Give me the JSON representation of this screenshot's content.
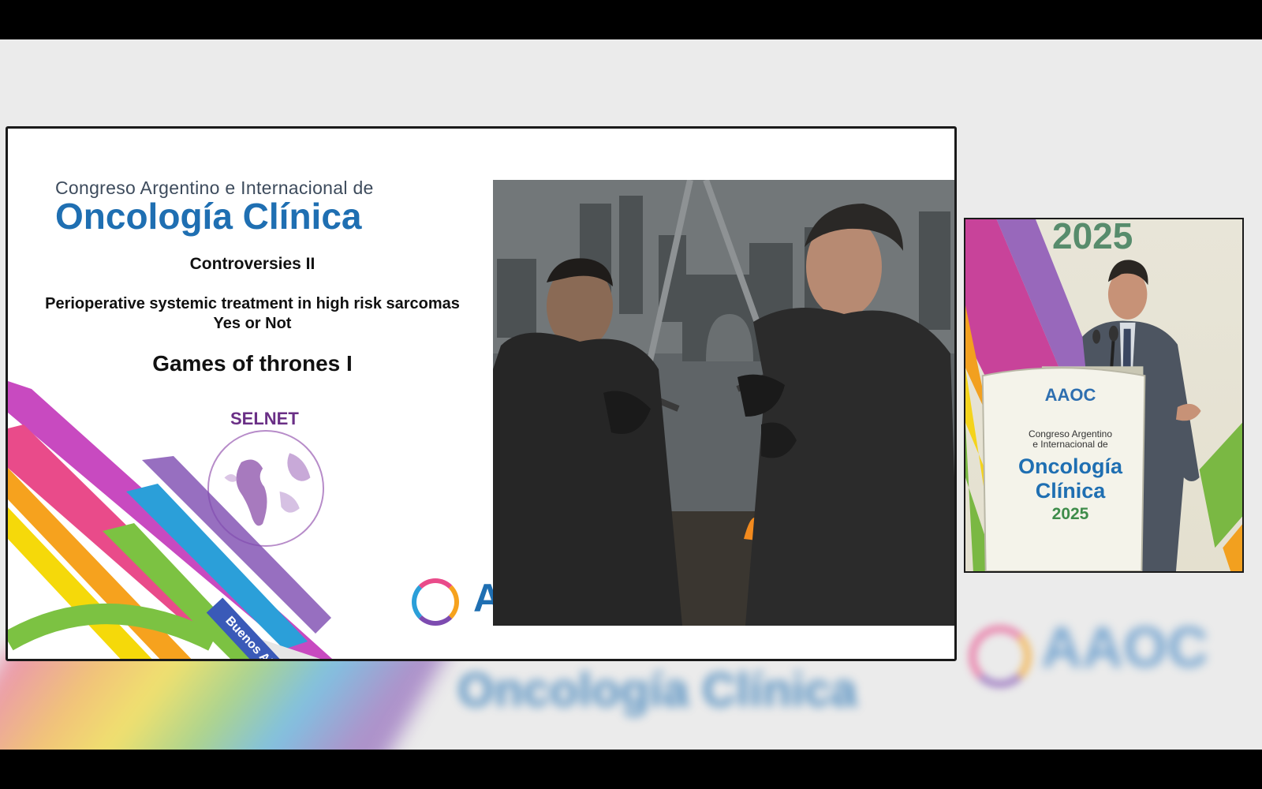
{
  "slide": {
    "congress_subtitle": "Congreso Argentino e Internacional de",
    "congress_title": "Oncología Clínica",
    "session": "Controversies II",
    "topic_line1": "Perioperative systemic treatment in high risk sarcomas",
    "topic_line2": "Yes or Not",
    "talk_title": "Games of thrones I",
    "selnet_label": "SELNET",
    "badge_city": "Buenos Aires",
    "footer_logo_letter": "A"
  },
  "speaker_feed": {
    "backdrop_year": "2025",
    "podium_brand": "AAOC",
    "podium_congress": "Congreso Argentino\ne Internacional de",
    "podium_title": "Oncología\nClínica",
    "podium_year": "2025"
  },
  "background": {
    "blur_text": "Oncología Clínica",
    "blur_logo": "AAOC"
  },
  "colors": {
    "brand_blue": "#1f6fb2",
    "selnet_purple": "#6a2f86",
    "badge_blue": "#3a5ab8",
    "year_green": "#3e8c4a"
  },
  "icons": {
    "footer_logo": "aaoc-ring-logo",
    "selnet_globe": "globe-icon"
  }
}
